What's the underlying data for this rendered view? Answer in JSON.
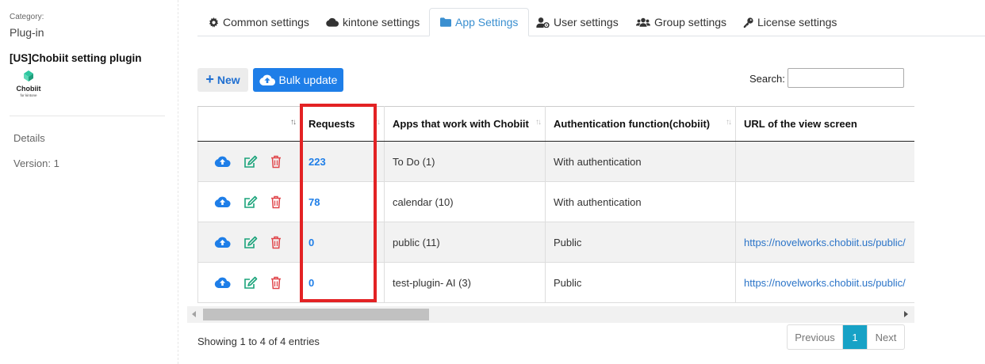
{
  "sidebar": {
    "category_label": "Category:",
    "category_value": "Plug-in",
    "plugin_title": "[US]Chobiit setting plugin",
    "logo_text": "Chobiit",
    "logo_subtext": "for kintone",
    "details": "Details",
    "version": "Version: 1"
  },
  "tabs": [
    {
      "label": "Common settings",
      "icon": "gear-icon"
    },
    {
      "label": "kintone settings",
      "icon": "cloud-icon"
    },
    {
      "label": "App Settings",
      "icon": "folder-icon",
      "active": true
    },
    {
      "label": "User settings",
      "icon": "user-cog-icon"
    },
    {
      "label": "Group settings",
      "icon": "users-icon"
    },
    {
      "label": "License settings",
      "icon": "key-icon"
    }
  ],
  "toolbar": {
    "new_label": "New",
    "bulk_label": "Bulk update",
    "search_label": "Search:",
    "search_value": ""
  },
  "table": {
    "headers": [
      "",
      "Requests",
      "Apps that work with Chobiit",
      "Authentication function(chobiit)",
      "URL of the view screen"
    ],
    "rows": [
      {
        "requests": "223",
        "app": "To Do (1)",
        "auth": "With authentication",
        "url": ""
      },
      {
        "requests": "78",
        "app": "calendar (10)",
        "auth": "With authentication",
        "url": ""
      },
      {
        "requests": "0",
        "app": "public (11)",
        "auth": "Public",
        "url": "https://novelworks.chobiit.us/public/"
      },
      {
        "requests": "0",
        "app": "test-plugin- AI (3)",
        "auth": "Public",
        "url": "https://novelworks.chobiit.us/public/"
      }
    ]
  },
  "footer": {
    "info": "Showing 1 to 4 of 4 entries",
    "previous": "Previous",
    "page": "1",
    "next": "Next"
  },
  "colors": {
    "primary": "#1e7ee8",
    "active_tab": "#3a8fd0",
    "edit": "#1aa37a",
    "delete": "#e0464b",
    "highlight": "#e32224",
    "pager_active": "#17a2c6"
  }
}
